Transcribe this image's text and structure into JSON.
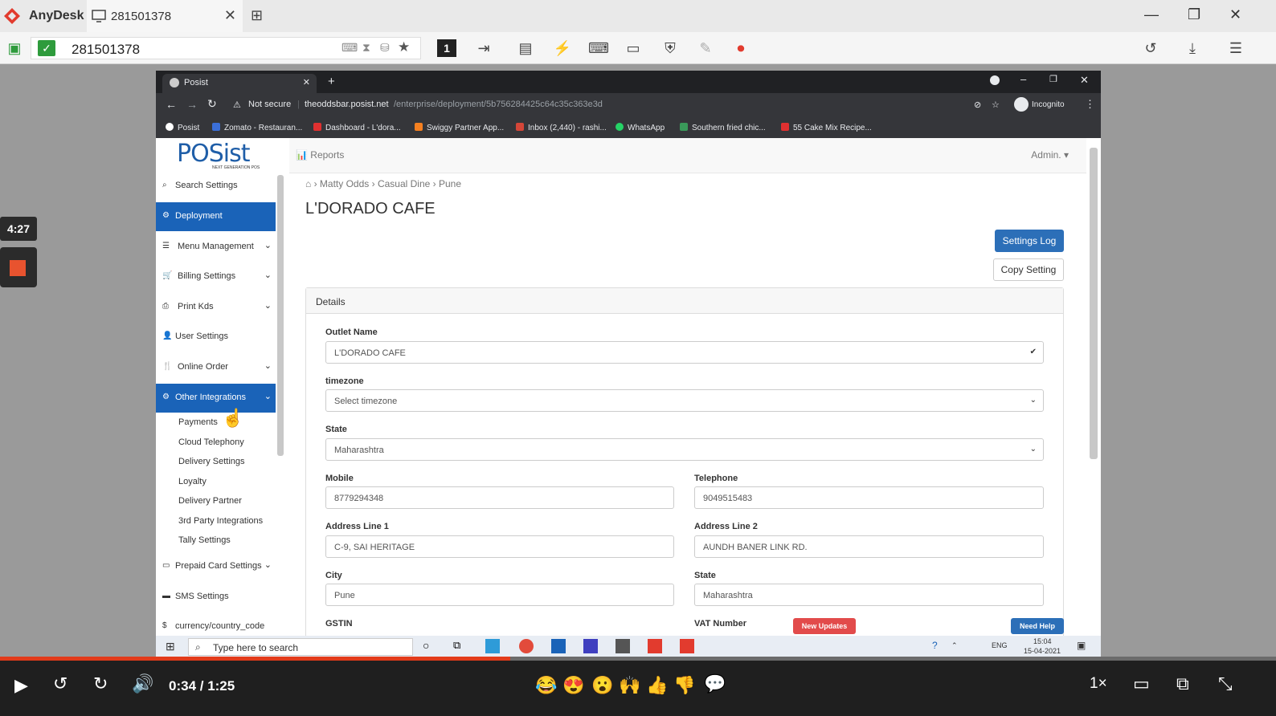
{
  "anydesk": {
    "brand": "AnyDesk",
    "tab_title": "281501378",
    "address": "281501378",
    "display_number": "1"
  },
  "chrome": {
    "tab_title": "Posist",
    "not_secure": "Not secure",
    "url_host": "theoddsbar.posist.net",
    "url_path": "/enterprise/deployment/5b756284425c64c35c363e3d",
    "incognito": "Incognito",
    "bookmarks": [
      {
        "label": "Posist",
        "color": "#ffffff"
      },
      {
        "label": "Zomato - Restauran...",
        "color": "#3b6fd8"
      },
      {
        "label": "Dashboard - L'dora...",
        "color": "#e03030"
      },
      {
        "label": "Swiggy Partner App...",
        "color": "#f58020"
      },
      {
        "label": "Inbox (2,440) - rashi...",
        "color": "#d44638"
      },
      {
        "label": "WhatsApp",
        "color": "#25d366"
      },
      {
        "label": "Southern fried chic...",
        "color": "#3a9a5a"
      },
      {
        "label": "55 Cake Mix Recipe...",
        "color": "#e03030"
      }
    ]
  },
  "posist": {
    "logo": "POSist",
    "logo_sub": "NEXT GENERATION POS",
    "reports": "Reports",
    "admin": "Admin.",
    "sidebar": {
      "search": "Search Settings",
      "items": [
        {
          "label": "Deployment",
          "active": true
        },
        {
          "label": "Menu Management"
        },
        {
          "label": "Billing Settings"
        },
        {
          "label": "Print Kds"
        },
        {
          "label": "User Settings"
        },
        {
          "label": "Online Order"
        },
        {
          "label": "Other Integrations",
          "active": true
        }
      ],
      "sub_items": [
        "Payments",
        "Cloud Telephony",
        "Delivery Settings",
        "Loyalty",
        "Delivery Partner",
        "3rd Party Integrations",
        "Tally Settings"
      ],
      "bottom_items": [
        "Prepaid Card Settings",
        "SMS Settings",
        "currency/country_code"
      ]
    },
    "breadcrumb": [
      "Matty Odds",
      "Casual Dine",
      "Pune"
    ],
    "title": "L'DORADO CAFE",
    "settings_log": "Settings Log",
    "copy_setting": "Copy Setting",
    "panel_title": "Details",
    "fields": {
      "outlet_name_label": "Outlet Name",
      "outlet_name": "L'DORADO CAFE",
      "timezone_label": "timezone",
      "timezone": "Select timezone",
      "state_label": "State",
      "state": "Maharashtra",
      "mobile_label": "Mobile",
      "mobile": "8779294348",
      "telephone_label": "Telephone",
      "telephone": "9049515483",
      "address1_label": "Address Line 1",
      "address1": "C-9, SAI HERITAGE",
      "address2_label": "Address Line 2",
      "address2": "AUNDH BANER LINK RD.",
      "city_label": "City",
      "city": "Pune",
      "state2_label": "State",
      "state2": "Maharashtra",
      "gstin_label": "GSTIN",
      "vat_label": "VAT Number"
    },
    "new_updates": "New Updates",
    "need_help": "Need Help"
  },
  "taskbar": {
    "search_placeholder": "Type here to search",
    "lang": "ENG",
    "time": "15:04",
    "date": "15-04-2021"
  },
  "player": {
    "elapsed_badge": "4:27",
    "time": "0:34 / 1:25",
    "speed": "1×",
    "progress": 0.4
  }
}
